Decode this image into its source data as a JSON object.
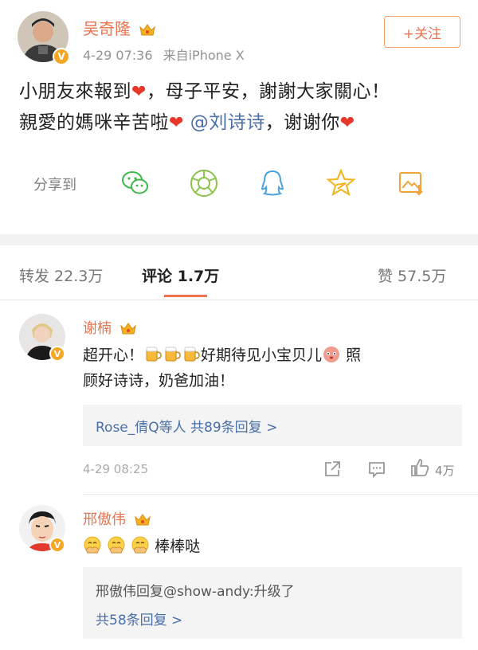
{
  "post": {
    "author": "吴奇隆",
    "time": "4-29 07:36",
    "source": "来自iPhone X",
    "follow_label": "+关注",
    "text_line1_a": "小朋友來報到",
    "text_line1_b": "，母子平安，謝謝大家關心！",
    "text_line2_a": "親愛的媽咪辛苦啦",
    "mention": "@刘诗诗",
    "text_line2_b": "，谢谢你",
    "verified_badge": "V"
  },
  "share": {
    "label": "分享到",
    "icons": [
      "wechat-icon",
      "moments-icon",
      "qq-icon",
      "qzone-icon",
      "save-image-icon"
    ]
  },
  "tabs": {
    "repost": "转发 22.3万",
    "comments": "评论 1.7万",
    "likes": "赞 57.5万"
  },
  "comments": [
    {
      "author": "谢楠",
      "text_a": "超开心！",
      "text_b": "好期待见小宝贝儿",
      "text_c": "照",
      "text_line2": "顾好诗诗，奶爸加油！",
      "reply_summary": "Rose_倩Q等人 共89条回复 >",
      "time": "4-29 08:25",
      "likes": "4万"
    },
    {
      "author": "邢傲伟",
      "text": "棒棒哒",
      "reply_line1": "邢傲伟回复@show-andy:升级了",
      "reply_line2": "共58条回复 >"
    }
  ],
  "colors": {
    "name": "#eb7350",
    "link": "#4a6ea8",
    "heart": "#e7372a",
    "badge": "#f5a623"
  }
}
